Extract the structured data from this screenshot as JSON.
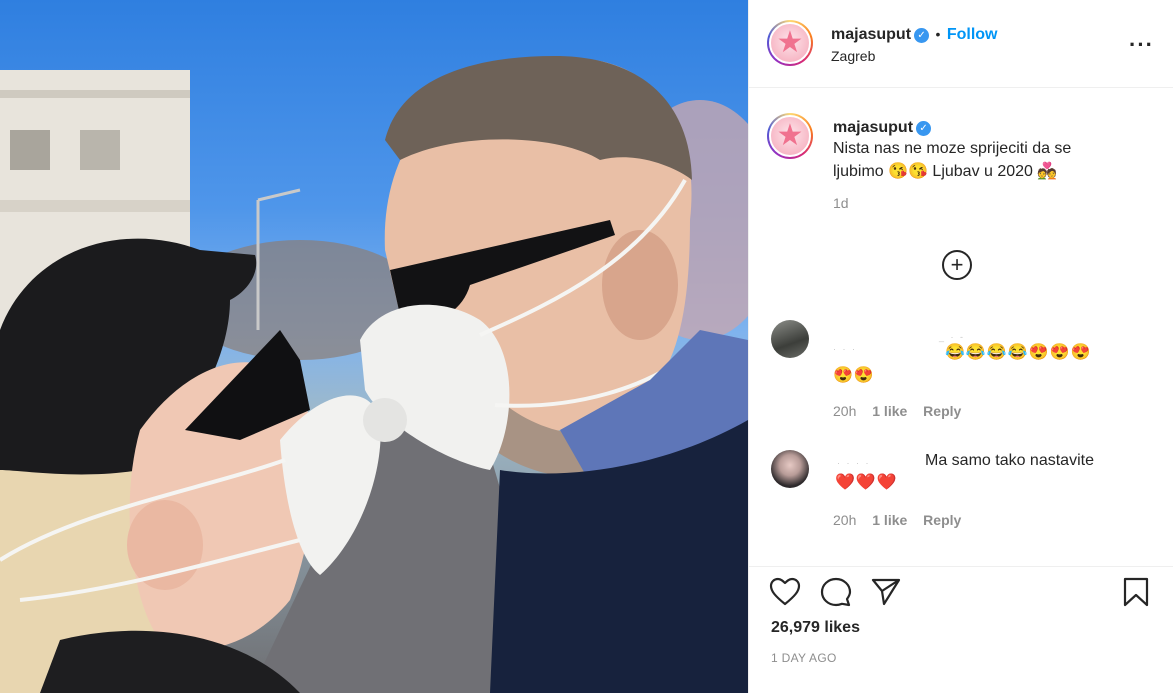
{
  "post": {
    "photo_description_icon": "photo-icon",
    "author": {
      "username": "majasuput",
      "verified_icon": "verified-badge-icon",
      "separator": "•",
      "follow_label": "Follow",
      "location": "Zagreb"
    },
    "caption": {
      "username": "majasuput",
      "line1": "Nista nas ne moze sprijeciti da se",
      "line2": "ljubimo 😘😘 Ljubav u 2020 💑",
      "time": "1d"
    },
    "comments": [
      {
        "text": "😂😂😂😂😍😍😍",
        "text2": "😍😍",
        "time": "20h",
        "likes": "1 like",
        "reply": "Reply"
      },
      {
        "emojis": "❤️❤️❤️",
        "text": "Ma samo tako nastavite",
        "time": "20h",
        "likes": "1 like",
        "reply": "Reply"
      }
    ],
    "likes_count": "26,979 likes",
    "date": "1 DAY AGO"
  },
  "colors": {
    "accent": "#0095f6",
    "verified": "#3897f0",
    "muted": "#8e8e8e",
    "text": "#262626"
  }
}
